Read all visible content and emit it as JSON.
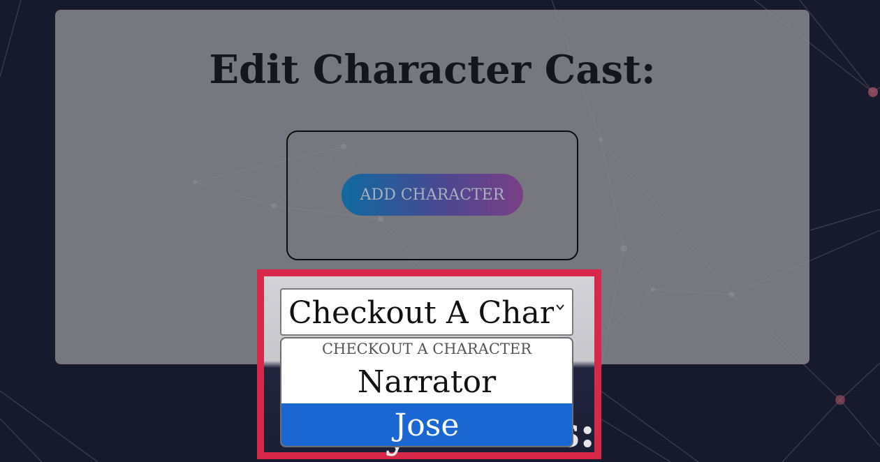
{
  "page": {
    "title": "Edit Character Cast:",
    "add_button_label": "ADD CHARACTER",
    "next_section_title": "Story Events:"
  },
  "character_select": {
    "selected_value": "Checkout A Character",
    "options": [
      {
        "label": "CHECKOUT A CHARACTER",
        "kind": "placeholder"
      },
      {
        "label": "Narrator",
        "kind": "option"
      },
      {
        "label": "Jose",
        "kind": "option",
        "highlighted": true
      }
    ]
  },
  "icons": {
    "select_arrow": "chevron-down-icon"
  },
  "colors": {
    "background": "#171a2c",
    "highlight_border": "#d8284a",
    "option_highlight": "#1a66d3",
    "button_gradient_start": "#0f6aa0",
    "button_gradient_end": "#7a3f86"
  }
}
